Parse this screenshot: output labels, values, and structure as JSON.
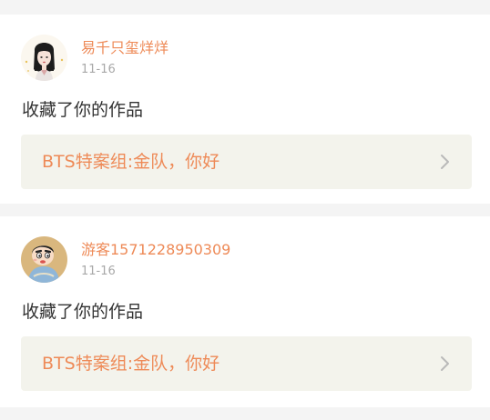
{
  "feed": {
    "items": [
      {
        "username": "易千只玺烊烊",
        "date": "11-16",
        "action": "收藏了你的作品",
        "work_title": "BTS特案组:金队，你好",
        "avatar_icon": "girl-portrait-avatar-icon"
      },
      {
        "username": "游客1571228950309",
        "date": "11-16",
        "action": "收藏了你的作品",
        "work_title": "BTS特案组:金队，你好",
        "avatar_icon": "cartoon-boy-avatar-icon"
      }
    ]
  },
  "colors": {
    "accent": "#ee8a57",
    "muted": "#a8a8a8",
    "text": "#333333",
    "link_bg": "#f3f3ec",
    "page_bg": "#f4f4f4"
  }
}
